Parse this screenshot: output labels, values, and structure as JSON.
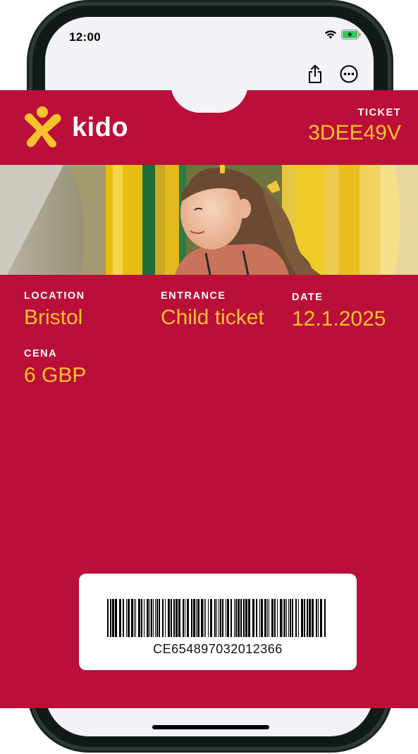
{
  "status_bar": {
    "time": "12:00",
    "icons": [
      "wifi-icon",
      "battery-charging-icon"
    ]
  },
  "nav": {
    "actions": [
      "share-icon",
      "more-options-icon"
    ]
  },
  "ticket": {
    "brand": "kido",
    "ticket_label": "TICKET",
    "ticket_code": "3DEE49V",
    "fields": {
      "location": {
        "label": "LOCATION",
        "value": "Bristol"
      },
      "entrance": {
        "label": "ENTRANCE",
        "value": "Child ticket"
      },
      "date": {
        "label": "DATE",
        "value": "12.1.2025"
      },
      "price": {
        "label": "CENA",
        "value": "6 GBP"
      }
    },
    "barcode_number": "CE654897032012366"
  },
  "colors": {
    "card": "#ba0f38",
    "accent": "#f8c22d",
    "phone_frame": "#2c3a37"
  }
}
